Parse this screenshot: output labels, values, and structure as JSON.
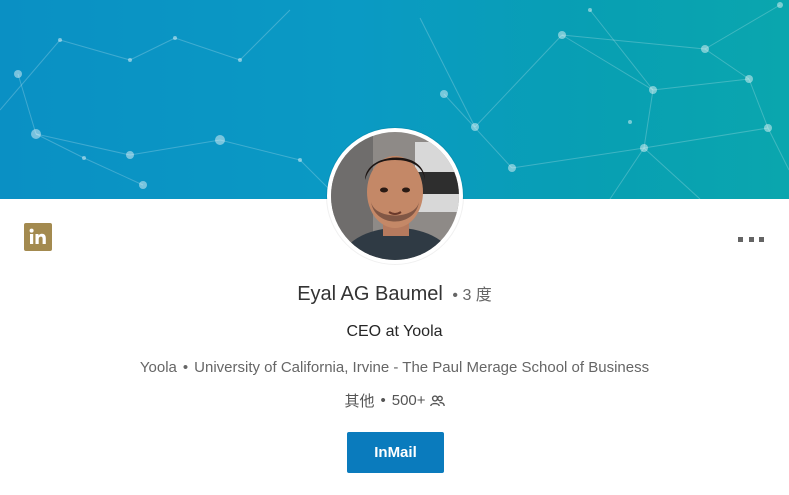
{
  "profile": {
    "name": "Eyal AG Baumel",
    "degree": "3 度",
    "headline": "CEO at Yoola",
    "company": "Yoola",
    "school": "University of California, Irvine - The Paul Merage School of Business",
    "location": "其他",
    "connections": "500+",
    "bullet": "•"
  },
  "actions": {
    "inmail_label": "InMail"
  },
  "icons": {
    "brand": "linkedin-logo-icon",
    "more": "more-horizontal-icon",
    "connections": "people-icon"
  },
  "colors": {
    "banner": "#0a96c2",
    "button": "#0a7bbd",
    "brand_logo": "#a38a4f"
  }
}
